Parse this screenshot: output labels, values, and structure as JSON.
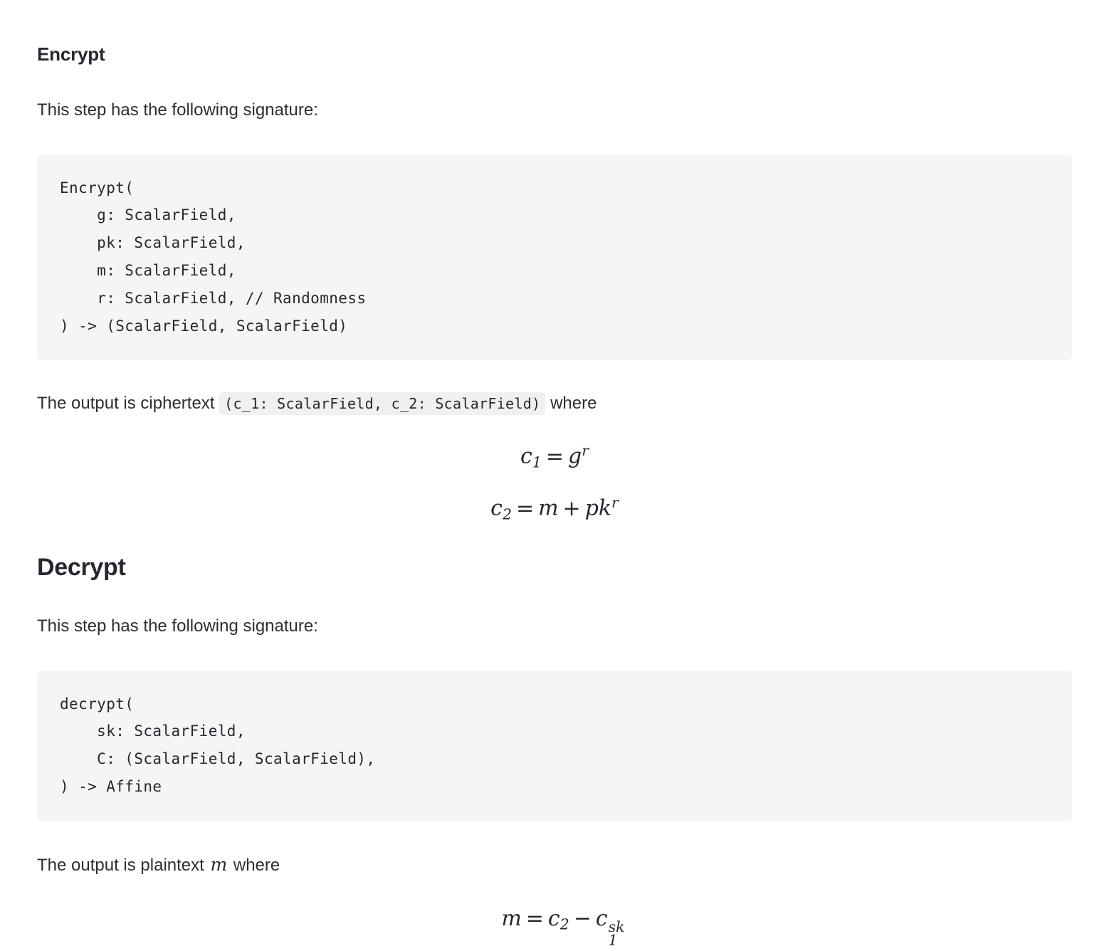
{
  "encrypt": {
    "heading": "Encrypt",
    "intro": "This step has the following signature:",
    "code": "Encrypt(\n    g: ScalarField,\n    pk: ScalarField,\n    m: ScalarField,\n    r: ScalarField, // Randomness\n) -> (ScalarField, ScalarField)",
    "output_prefix": "The output is ciphertext",
    "output_inline_code": "(c_1: ScalarField, c_2: ScalarField)",
    "output_suffix": "where",
    "equations": [
      {
        "lhs_base": "c",
        "lhs_sub": "1",
        "operator": "=",
        "rhs_base": "g",
        "rhs_sup": "r",
        "plain": "c_1 = g^r"
      },
      {
        "lhs_base": "c",
        "lhs_sub": "2",
        "operator": "=",
        "rhs_term1": "m",
        "rhs_operator": "+",
        "rhs_base": "pk",
        "rhs_sup": "r",
        "plain": "c_2 = m + pk^r"
      }
    ]
  },
  "decrypt": {
    "heading": "Decrypt",
    "intro": "This step has the following signature:",
    "code": "decrypt(\n    sk: ScalarField,\n    C: (ScalarField, ScalarField),\n) -> Affine",
    "output_prefix": "The output is plaintext",
    "output_inline_math": "m",
    "output_suffix": "where",
    "equation": {
      "lhs": "m",
      "operator": "=",
      "rhs_base1": "c",
      "rhs_sub1": "2",
      "rhs_operator": "−",
      "rhs_base2": "c",
      "rhs_sub2": "1",
      "rhs_sup2": "sk",
      "plain": "m = c_2 - c_1^{sk}"
    }
  },
  "colors": {
    "page_background": "#ffffff",
    "text": "#24292f",
    "code_block_background": "#f5f5f5",
    "inline_code_background": "#f0f0f0"
  }
}
